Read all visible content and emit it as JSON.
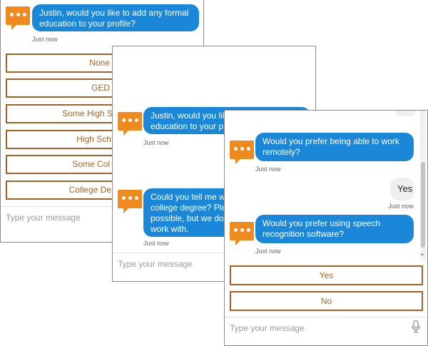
{
  "panel1": {
    "bot_message": "Justin, would you like to add any formal\neducation to your profile?",
    "timestamp": "Just now",
    "choices": [
      "None",
      "GED",
      "Some High S",
      "High Sch",
      "Some Col",
      "College De"
    ],
    "input_placeholder": "Type your message"
  },
  "panel2": {
    "message1": "Justin, would you like\neducation to your profi",
    "timestamp1": "Just now",
    "message2": "Could you tell me whe\ncollege degree? Pleas\npossible, but we do a\nwork with.",
    "timestamp2": "Just now",
    "input_placeholder": "Type your message"
  },
  "panel3": {
    "message1": "Would you prefer being able to work\nremotely?",
    "timestamp1": "Just now",
    "user_reply": "Yes",
    "timestamp2": "Just now",
    "message2": "Would you prefer using speech\nrecognition software?",
    "timestamp3": "Just now",
    "choices": [
      "Yes",
      "No"
    ],
    "input_placeholder": "Type your message",
    "scroll_arrow": "⌄"
  },
  "colors": {
    "bot_bubble": "#1a87d9",
    "avatar": "#ef8a1f",
    "choice_border": "#a0642a",
    "user_bubble": "#efefef"
  },
  "icons": [
    "chat-avatar-icon",
    "microphone-icon"
  ]
}
